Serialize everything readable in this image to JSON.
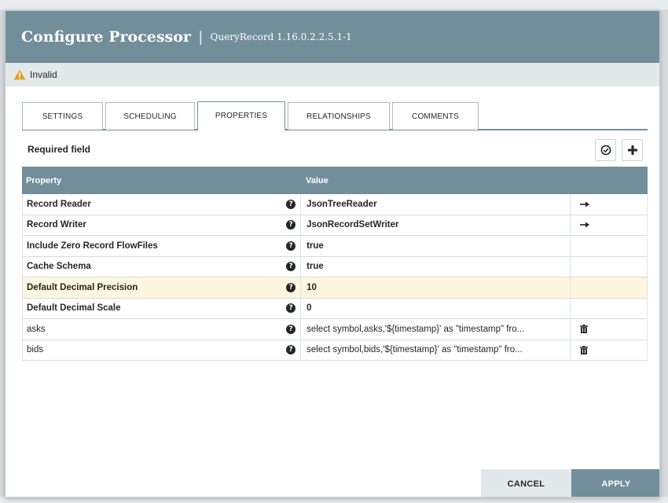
{
  "dialog": {
    "title": "Configure Processor",
    "separator": "|",
    "subtitle": "QueryRecord 1.16.0.2.2.5.1-1"
  },
  "status": {
    "text": "Invalid",
    "icon": "warning-icon",
    "color": "#e6a12c"
  },
  "tabs": [
    {
      "label": "SETTINGS"
    },
    {
      "label": "SCHEDULING"
    },
    {
      "label": "PROPERTIES",
      "active": true
    },
    {
      "label": "RELATIONSHIPS"
    },
    {
      "label": "COMMENTS"
    }
  ],
  "properties_panel": {
    "required_label": "Required field",
    "verify_icon": "verify-icon",
    "add_icon": "add-property-icon",
    "columns": {
      "property": "Property",
      "value": "Value"
    },
    "rows": [
      {
        "name": "Record Reader",
        "value": "JsonTreeReader",
        "required": true,
        "action": "go-to-arrow-icon"
      },
      {
        "name": "Record Writer",
        "value": "JsonRecordSetWriter",
        "required": true,
        "action": "go-to-arrow-icon"
      },
      {
        "name": "Include Zero Record FlowFiles",
        "value": "true",
        "required": true,
        "action": ""
      },
      {
        "name": "Cache Schema",
        "value": "true",
        "required": true,
        "action": ""
      },
      {
        "name": "Default Decimal Precision",
        "value": "10",
        "required": true,
        "action": "",
        "highlighted": true
      },
      {
        "name": "Default Decimal Scale",
        "value": "0",
        "required": true,
        "action": ""
      },
      {
        "name": "asks",
        "value": "select symbol,asks,'${timestamp}' as \"timestamp\" fro...",
        "required": false,
        "action": "trash-icon"
      },
      {
        "name": "bids",
        "value": "select symbol,bids,'${timestamp}' as \"timestamp\" fro...",
        "required": false,
        "action": "trash-icon"
      }
    ]
  },
  "footer": {
    "cancel_label": "CANCEL",
    "apply_label": "APPLY"
  },
  "colors": {
    "header": "#728e9b",
    "status_bar": "#e3e8eb",
    "highlight_row": "#fcf6e0"
  }
}
